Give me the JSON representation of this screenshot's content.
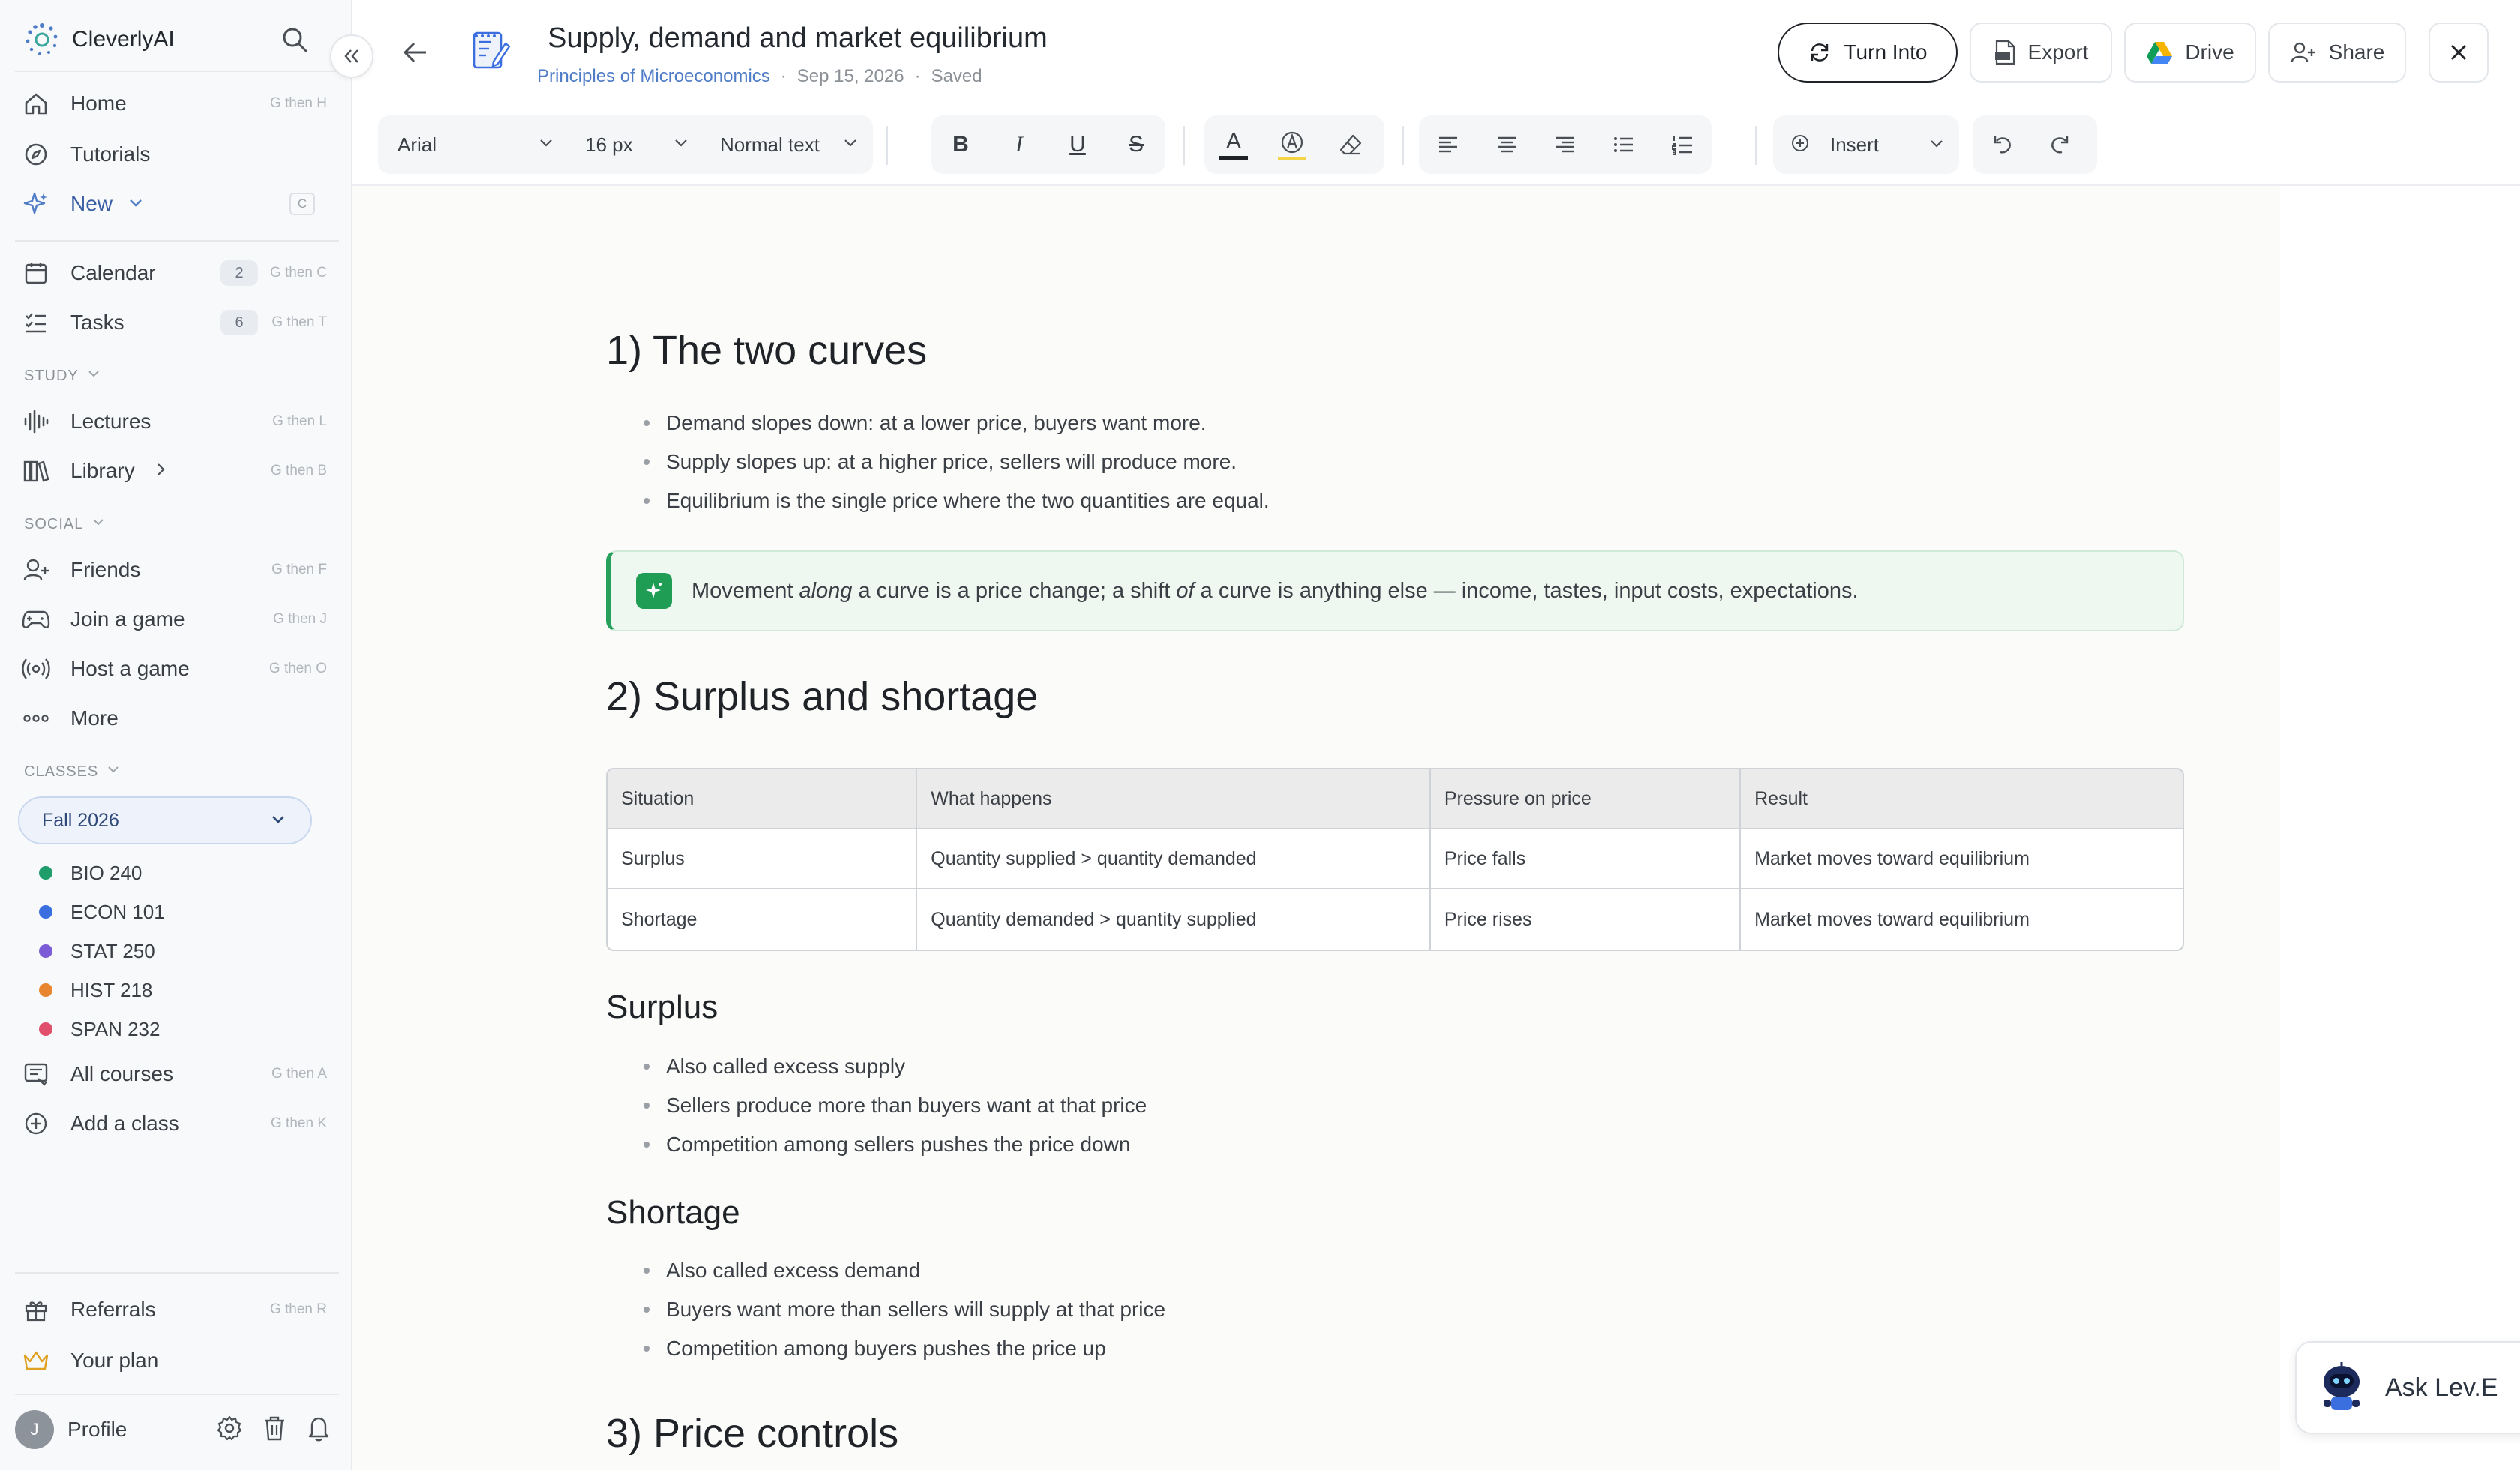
{
  "app": {
    "name": "CleverlyAI"
  },
  "sidebar": {
    "nav_primary": [
      {
        "label": "Home",
        "shortcut": "G then H",
        "icon": "home-icon"
      },
      {
        "label": "Tutorials",
        "shortcut": "",
        "icon": "compass-icon"
      },
      {
        "label": "New",
        "shortcut": "C",
        "icon": "sparkle-icon"
      }
    ],
    "nav_schedule": [
      {
        "label": "Calendar",
        "count": "2",
        "shortcut": "G then C"
      },
      {
        "label": "Tasks",
        "count": "6",
        "shortcut": "G then T"
      }
    ],
    "study_heading": "STUDY",
    "study": [
      {
        "label": "Lectures",
        "shortcut": "G then L"
      },
      {
        "label": "Library",
        "shortcut": "G then B"
      }
    ],
    "social_heading": "SOCIAL",
    "social": [
      {
        "label": "Friends",
        "shortcut": "G then F"
      },
      {
        "label": "Join a game",
        "shortcut": "G then J"
      },
      {
        "label": "Host a game",
        "shortcut": "G then O"
      },
      {
        "label": "More",
        "shortcut": ""
      }
    ],
    "classes_heading": "CLASSES",
    "term": "Fall 2026",
    "classes": [
      {
        "label": "BIO 240",
        "color": "#1f9d6b"
      },
      {
        "label": "ECON 101",
        "color": "#3b6fe0"
      },
      {
        "label": "STAT 250",
        "color": "#7b5cd6"
      },
      {
        "label": "HIST 218",
        "color": "#e8862f"
      },
      {
        "label": "SPAN 232",
        "color": "#e0506a"
      }
    ],
    "all_courses": {
      "label": "All courses",
      "shortcut": "G then A"
    },
    "add_class": {
      "label": "Add a class",
      "shortcut": "G then K"
    },
    "referrals": {
      "label": "Referrals",
      "shortcut": "G then R"
    },
    "your_plan": {
      "label": "Your plan"
    },
    "profile": {
      "label": "Profile",
      "initial": "J"
    }
  },
  "header": {
    "title": "Supply, demand and market equilibrium",
    "course": "Principles of Microeconomics",
    "date": "Sep 15, 2026",
    "status": "Saved",
    "sep": "·",
    "buttons": {
      "turn_into": "Turn Into",
      "export": "Export",
      "drive": "Drive",
      "share": "Share"
    }
  },
  "toolbar": {
    "font": "Arial",
    "size": "16 px",
    "style": "Normal text",
    "insert": "Insert",
    "bold": "B",
    "italic": "I",
    "underline": "U",
    "strike": "S",
    "text_color": "A"
  },
  "doc": {
    "s1_heading": "1) The two curves",
    "s1_bullets": [
      "Demand slopes down: at a lower price, buyers want more.",
      "Supply slopes up: at a higher price, sellers will produce more.",
      "Equilibrium is the single price where the two quantities are equal."
    ],
    "callout": {
      "p1": "Movement ",
      "em1": "along",
      "p2": " a curve is a price change; a shift ",
      "em2": "of",
      "p3": " a curve is anything else — income, tastes, input costs, expectations."
    },
    "s2_heading": "2) Surplus and shortage",
    "table": {
      "headers": [
        "Situation",
        "What happens",
        "Pressure on price",
        "Result"
      ],
      "rows": [
        [
          "Surplus",
          "Quantity supplied > quantity demanded",
          "Price falls",
          "Market moves toward equilibrium"
        ],
        [
          "Shortage",
          "Quantity demanded > quantity supplied",
          "Price rises",
          "Market moves toward equilibrium"
        ]
      ]
    },
    "surplus_heading": "Surplus",
    "surplus_bullets": [
      "Also called excess supply",
      "Sellers produce more than buyers want at that price",
      "Competition among sellers pushes the price down"
    ],
    "shortage_heading": "Shortage",
    "shortage_bullets": [
      "Also called excess demand",
      "Buyers want more than sellers will supply at that price",
      "Competition among buyers pushes the price up"
    ],
    "s3_heading": "3) Price controls"
  },
  "assistant": {
    "label": "Ask Lev.E"
  }
}
